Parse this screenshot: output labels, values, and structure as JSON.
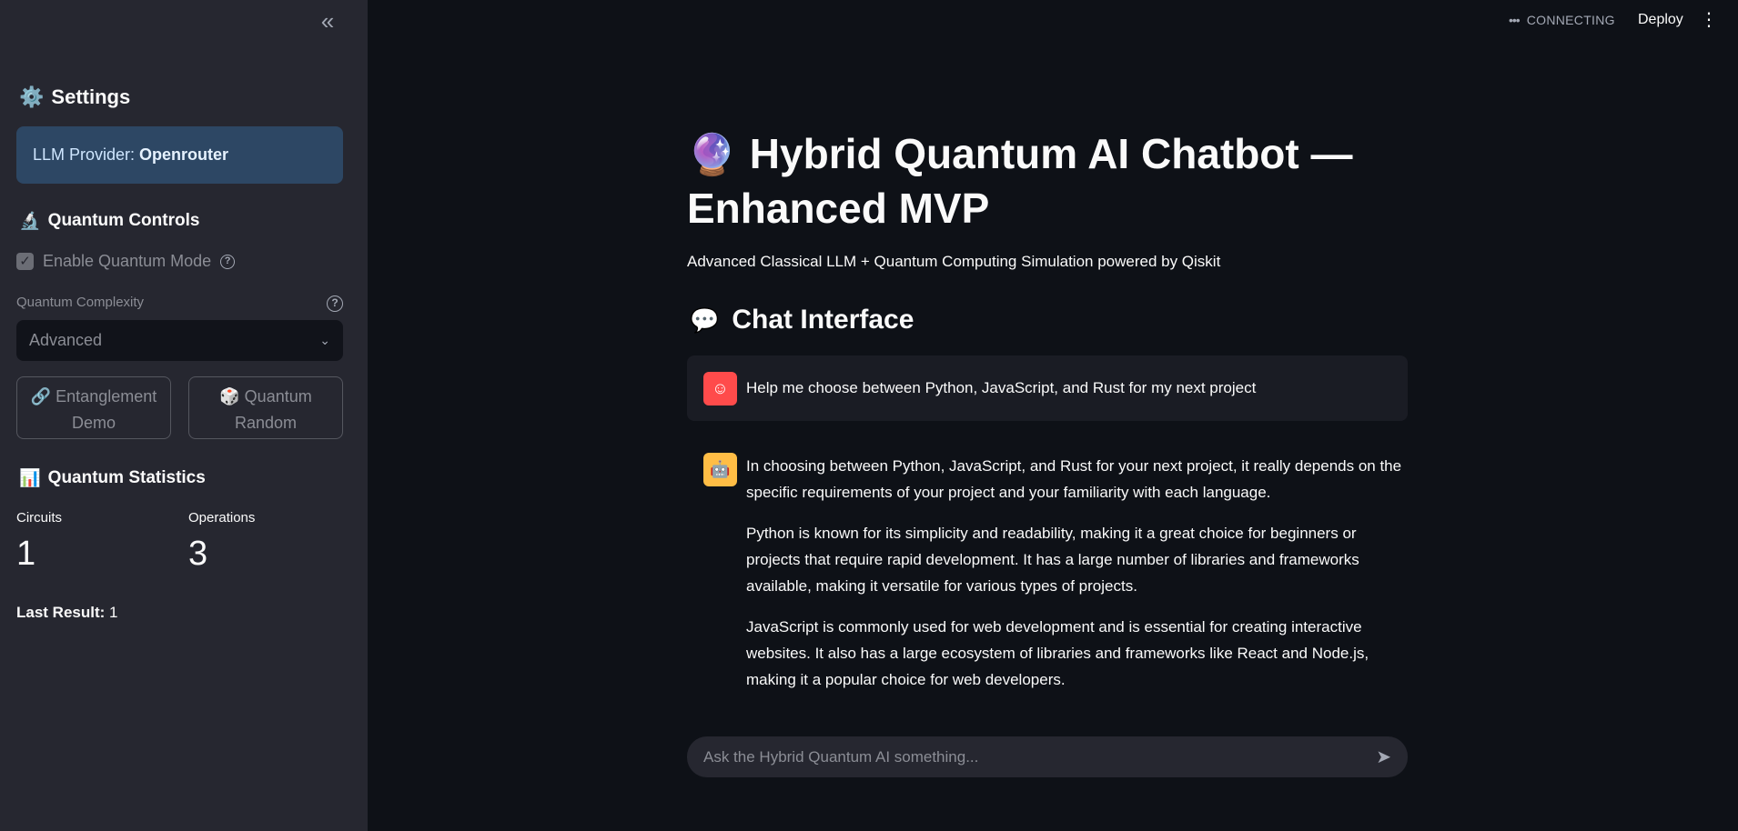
{
  "sidebar": {
    "collapse_icon": "«",
    "settings_title": "Settings",
    "settings_icon": "⚙️",
    "provider_label": "LLM Provider:",
    "provider_value": "Openrouter",
    "quantum_controls_title": "Quantum Controls",
    "quantum_controls_icon": "🔬",
    "enable_quantum_label": "Enable Quantum Mode",
    "enable_quantum_checked": true,
    "complexity_label": "Quantum Complexity",
    "complexity_value": "Advanced",
    "entanglement_button": "🔗 Entanglement Demo",
    "random_button": "🎲 Quantum Random",
    "stats_title": "Quantum Statistics",
    "stats_icon": "📊",
    "circuits_label": "Circuits",
    "circuits_value": "1",
    "operations_label": "Operations",
    "operations_value": "3",
    "last_result_label": "Last Result:",
    "last_result_value": "1"
  },
  "topbar": {
    "status": "CONNECTING",
    "deploy": "Deploy"
  },
  "main": {
    "title_emoji": "🔮",
    "title": "Hybrid Quantum AI Chatbot — Enhanced MVP",
    "subtitle": "Advanced Classical LLM + Quantum Computing Simulation powered by Qiskit",
    "chat_heading": "Chat Interface",
    "chat_icon": "💬"
  },
  "messages": {
    "user": "Help me choose between Python, JavaScript, and Rust for my next project",
    "assistant_p1": "In choosing between Python, JavaScript, and Rust for your next project, it really depends on the specific requirements of your project and your familiarity with each language.",
    "assistant_p2": "Python is known for its simplicity and readability, making it a great choice for beginners or projects that require rapid development. It has a large number of libraries and frameworks available, making it versatile for various types of projects.",
    "assistant_p3": "JavaScript is commonly used for web development and is essential for creating interactive websites. It also has a large ecosystem of libraries and frameworks like React and Node.js, making it a popular choice for web developers."
  },
  "input": {
    "placeholder": "Ask the Hybrid Quantum AI something..."
  },
  "colors": {
    "sidebar_bg": "#262730",
    "main_bg": "#0e1117",
    "provider_box": "#2d4764",
    "user_avatar": "#ff4b4b",
    "bot_avatar": "#ffbd45"
  },
  "icons": {
    "collapse": "chevron-double-left-icon",
    "send": "send-icon",
    "kebab": "kebab-menu-icon",
    "user_avatar": "user-face-icon",
    "bot_avatar": "robot-icon"
  }
}
